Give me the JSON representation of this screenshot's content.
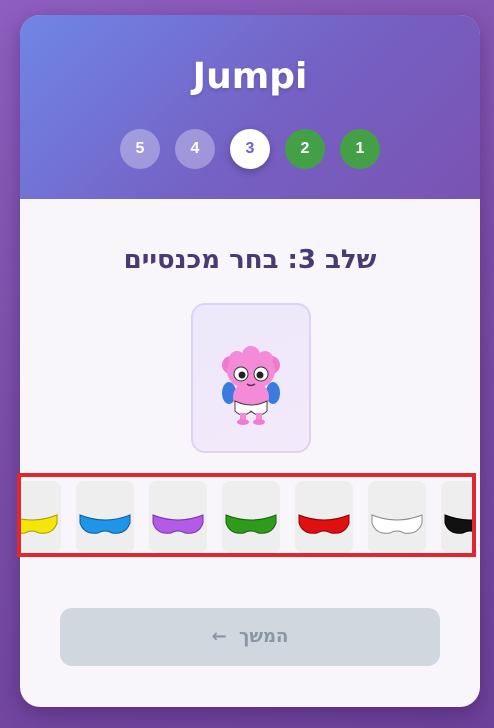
{
  "app": {
    "title": "Jumpi"
  },
  "steps": [
    {
      "label": "5",
      "state": "pending"
    },
    {
      "label": "4",
      "state": "pending"
    },
    {
      "label": "3",
      "state": "current"
    },
    {
      "label": "2",
      "state": "done"
    },
    {
      "label": "1",
      "state": "done"
    }
  ],
  "step_title": "שלב 3: בחר מכנסיים",
  "preview": {
    "character": "pink-creature-icon"
  },
  "pants_options": [
    {
      "name": "yellow",
      "color": "#f5e60a"
    },
    {
      "name": "blue",
      "color": "#1e95e8"
    },
    {
      "name": "purple",
      "color": "#b35be6"
    },
    {
      "name": "green",
      "color": "#2e9b1b"
    },
    {
      "name": "red",
      "color": "#e01010"
    },
    {
      "name": "white",
      "color": "#ffffff"
    },
    {
      "name": "black",
      "color": "#111111"
    }
  ],
  "continue_button": {
    "label": "המשך",
    "icon": "arrow-left-icon"
  },
  "colors": {
    "accent": "#6a63c9",
    "done": "#43a047",
    "highlight": "#e0262f"
  }
}
